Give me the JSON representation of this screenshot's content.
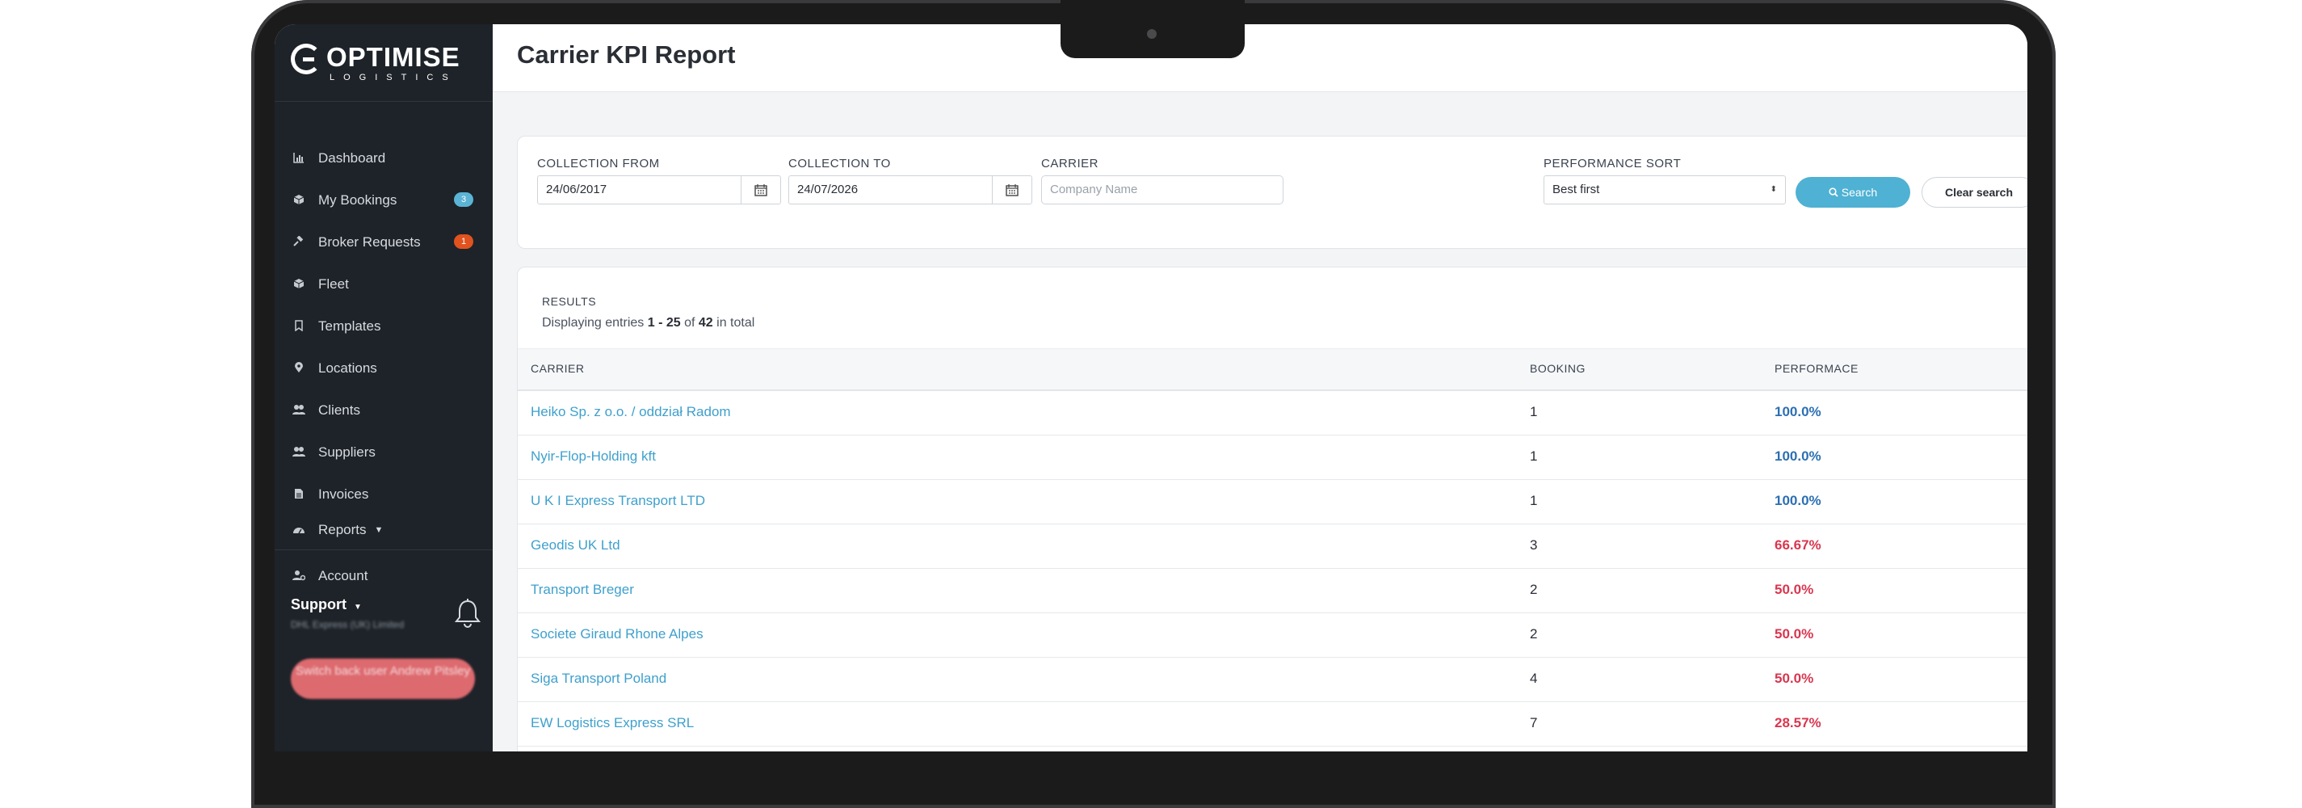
{
  "app": {
    "logo_text": "OPTIMISE",
    "logo_sub": "LOGISTICS",
    "page_title": "Carrier KPI Report"
  },
  "sidebar": {
    "items": [
      {
        "label": "Dashboard",
        "icon": "bar-chart-icon"
      },
      {
        "label": "My Bookings",
        "icon": "cube-icon",
        "badge": "3",
        "badge_color": "#5bb4d6"
      },
      {
        "label": "Broker Requests",
        "icon": "gavel-icon",
        "badge": "1",
        "badge_color": "#e0531f"
      },
      {
        "label": "Fleet",
        "icon": "cube-icon"
      },
      {
        "label": "Templates",
        "icon": "bookmark-icon"
      },
      {
        "label": "Locations",
        "icon": "map-pin-icon"
      },
      {
        "label": "Clients",
        "icon": "users-icon"
      },
      {
        "label": "Suppliers",
        "icon": "users-icon"
      },
      {
        "label": "Invoices",
        "icon": "file-icon"
      },
      {
        "label": "Reports",
        "icon": "dashboard-icon"
      },
      {
        "label": "Account",
        "icon": "user-cog-icon"
      }
    ],
    "support_label": "Support",
    "support_company": "DHL Express (UK) Limited",
    "switch_button": "Switch back user Andrew Pitsley"
  },
  "filters": {
    "collection_from_label": "COLLECTION FROM",
    "collection_from_value": "24/06/2017",
    "collection_to_label": "COLLECTION TO",
    "collection_to_value": "24/07/2026",
    "carrier_label": "CARRIER",
    "carrier_placeholder": "Company Name",
    "performance_sort_label": "PERFORMANCE SORT",
    "performance_sort_value": "Best first",
    "search_button": "Search",
    "clear_button": "Clear search"
  },
  "results": {
    "title": "RESULTS",
    "summary_prefix": "Displaying entries",
    "summary_range": "1 - 25",
    "summary_of": "of",
    "summary_total": "42",
    "summary_suffix": "in total",
    "columns": [
      "CARRIER",
      "BOOKING",
      "PERFORMACE"
    ],
    "rows": [
      {
        "carrier": "Heiko Sp. z o.o. / oddział Radom",
        "booking": "1",
        "performance": "100.0%",
        "perf_color": "#2b6fb4"
      },
      {
        "carrier": "Nyir-Flop-Holding kft",
        "booking": "1",
        "performance": "100.0%",
        "perf_color": "#2b6fb4"
      },
      {
        "carrier": "U K I Express Transport LTD",
        "booking": "1",
        "performance": "100.0%",
        "perf_color": "#2b6fb4"
      },
      {
        "carrier": "Geodis UK Ltd",
        "booking": "3",
        "performance": "66.67%",
        "perf_color": "#d9364f"
      },
      {
        "carrier": "Transport Breger",
        "booking": "2",
        "performance": "50.0%",
        "perf_color": "#d9364f"
      },
      {
        "carrier": "Societe Giraud Rhone Alpes",
        "booking": "2",
        "performance": "50.0%",
        "perf_color": "#d9364f"
      },
      {
        "carrier": "Siga Transport Poland",
        "booking": "4",
        "performance": "50.0%",
        "perf_color": "#d9364f"
      },
      {
        "carrier": "EW Logistics Express SRL",
        "booking": "7",
        "performance": "28.57%",
        "perf_color": "#d9364f"
      }
    ]
  }
}
